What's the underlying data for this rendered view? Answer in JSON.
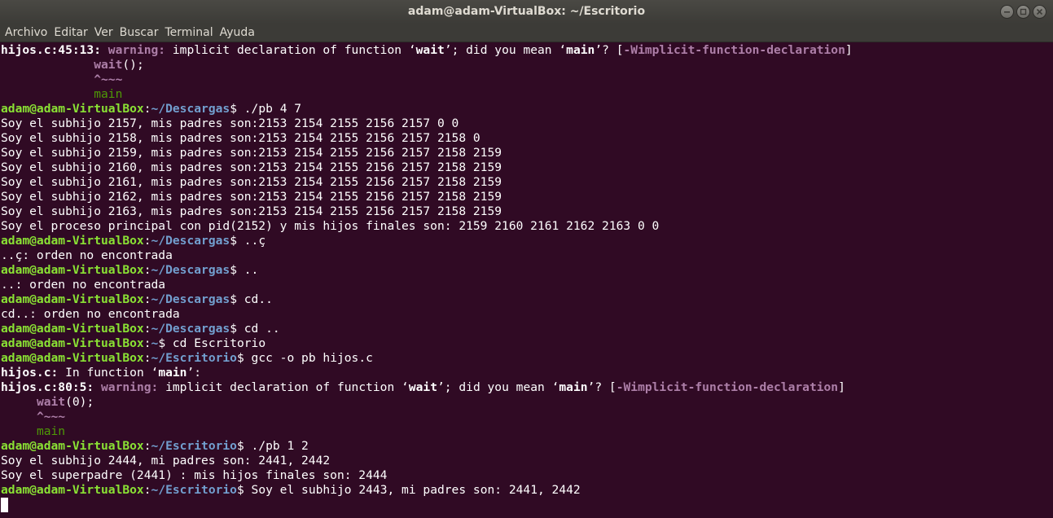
{
  "window": {
    "title": "adam@adam-VirtualBox: ~/Escritorio",
    "buttons": [
      "minimize-icon",
      "maximize-icon",
      "close-icon"
    ]
  },
  "menu": [
    "Archivo",
    "Editar",
    "Ver",
    "Buscar",
    "Terminal",
    "Ayuda"
  ],
  "colors": {
    "background": "#300a24",
    "user": "#8ae234",
    "path": "#729fcf",
    "warning": "#ad7fa8",
    "fixit": "#4e9a06"
  },
  "lines": [
    "hijos.c:45:13: warning: implicit declaration of function ‘wait’; did you mean ‘main’? [-Wimplicit-function-declaration]",
    "             wait();",
    "             ^~~~",
    "             main",
    "adam@adam-VirtualBox:~/Descargas$ ./pb 4 7",
    "Soy el subhijo 2157, mis padres son:2153 2154 2155 2156 2157 0 0",
    "Soy el subhijo 2158, mis padres son:2153 2154 2155 2156 2157 2158 0",
    "Soy el subhijo 2159, mis padres son:2153 2154 2155 2156 2157 2158 2159",
    "Soy el subhijo 2160, mis padres son:2153 2154 2155 2156 2157 2158 2159",
    "Soy el subhijo 2161, mis padres son:2153 2154 2155 2156 2157 2158 2159",
    "Soy el subhijo 2162, mis padres son:2153 2154 2155 2156 2157 2158 2159",
    "Soy el subhijo 2163, mis padres son:2153 2154 2155 2156 2157 2158 2159",
    "Soy el proceso principal con pid(2152) y mis hijos finales son: 2159 2160 2161 2162 2163 0 0",
    "adam@adam-VirtualBox:~/Descargas$ ..ç",
    "..ç: orden no encontrada",
    "adam@adam-VirtualBox:~/Descargas$ ..",
    "..: orden no encontrada",
    "adam@adam-VirtualBox:~/Descargas$ cd..",
    "cd..: orden no encontrada",
    "adam@adam-VirtualBox:~/Descargas$ cd ..",
    "adam@adam-VirtualBox:~$ cd Escritorio",
    "adam@adam-VirtualBox:~/Escritorio$ gcc -o pb hijos.c",
    "hijos.c: In function ‘main’:",
    "hijos.c:80:5: warning: implicit declaration of function ‘wait’; did you mean ‘main’? [-Wimplicit-function-declaration]",
    "     wait(0);",
    "     ^~~~",
    "     main",
    "adam@adam-VirtualBox:~/Escritorio$ ./pb 1 2",
    "Soy el subhijo 2444, mi padres son: 2441, 2442",
    "Soy el superpadre (2441) : mis hijos finales son: 2444",
    "adam@adam-VirtualBox:~/Escritorio$ Soy el subhijo 2443, mi padres son: 2441, 2442"
  ]
}
